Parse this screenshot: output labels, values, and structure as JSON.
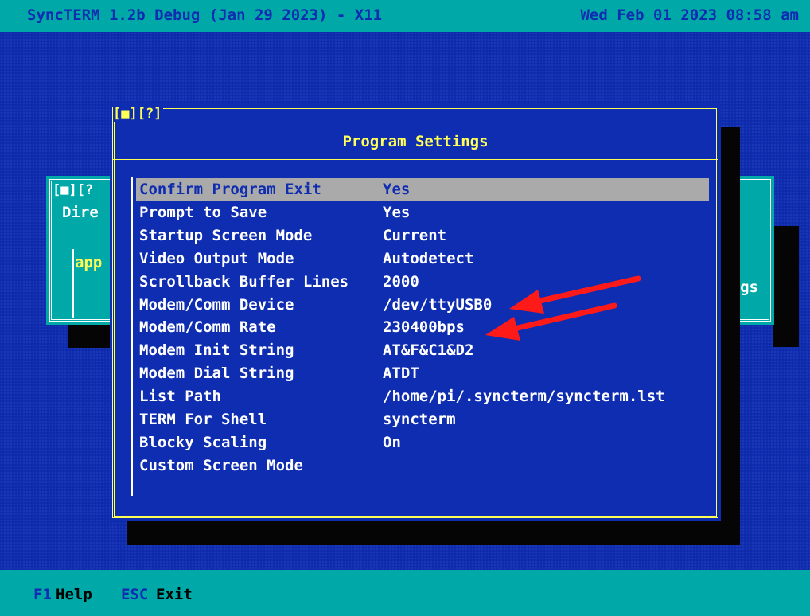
{
  "titlebar": {
    "title": "SyncTERM 1.2b Debug (Jan 29 2023) - X11",
    "clock": "Wed Feb 01 2023 08:58 am"
  },
  "directory_window": {
    "controls": "[■][?",
    "title": "Dire",
    "entry": "app",
    "right_fragment": "ings"
  },
  "settings_dialog": {
    "controls": "[■][?]",
    "title": "Program Settings",
    "selected_index": 0,
    "items": [
      {
        "name": "Confirm Program Exit",
        "value": "Yes"
      },
      {
        "name": "Prompt to Save",
        "value": "Yes"
      },
      {
        "name": "Startup Screen Mode",
        "value": "Current"
      },
      {
        "name": "Video Output Mode",
        "value": "Autodetect"
      },
      {
        "name": "Scrollback Buffer Lines",
        "value": "2000"
      },
      {
        "name": "Modem/Comm Device",
        "value": "/dev/ttyUSB0"
      },
      {
        "name": "Modem/Comm Rate",
        "value": "230400bps"
      },
      {
        "name": "Modem Init String",
        "value": "AT&F&C1&D2"
      },
      {
        "name": "Modem Dial String",
        "value": "ATDT"
      },
      {
        "name": "List Path",
        "value": "/home/pi/.syncterm/syncterm.lst"
      },
      {
        "name": "TERM For Shell",
        "value": "syncterm"
      },
      {
        "name": "Blocky Scaling",
        "value": "On"
      },
      {
        "name": "Custom Screen Mode",
        "value": ""
      }
    ]
  },
  "statusbar": {
    "keys": [
      {
        "key": "F1",
        "label": "Help"
      },
      {
        "key": "ESC",
        "label": "Exit"
      }
    ]
  },
  "colors": {
    "desktop": "#0f2db0",
    "bar": "#00a8a8",
    "highlight": "#ffff55",
    "selection": "#aaaaaa",
    "annotation_arrow": "#ff1a1a"
  }
}
